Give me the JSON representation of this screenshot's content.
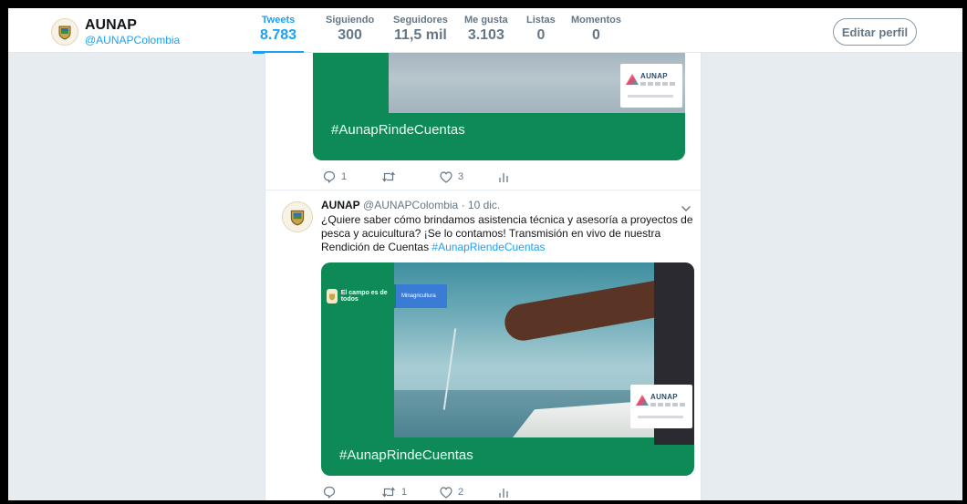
{
  "profile": {
    "name": "AUNAP",
    "handle": "@AUNAPColombia"
  },
  "stats": [
    {
      "label": "Tweets",
      "value": "8.783"
    },
    {
      "label": "Siguiendo",
      "value": "300"
    },
    {
      "label": "Seguidores",
      "value": "11,5 mil"
    },
    {
      "label": "Me gusta",
      "value": "3.103"
    },
    {
      "label": "Listas",
      "value": "0"
    },
    {
      "label": "Momentos",
      "value": "0"
    }
  ],
  "edit_profile_label": "Editar perfil",
  "tweet1": {
    "card_hashtag": "#AunapRindeCuentas",
    "badge_text": "AUNAP",
    "reply_count": "1",
    "retweet_count": "",
    "like_count": "3"
  },
  "tweet2": {
    "user_name": "AUNAP",
    "handle": "@AUNAPColombia",
    "date": "· 10 dic.",
    "text": "¿Quiere saber cómo brindamos asistencia técnica y asesoría a proyectos de pesca y acuicultura? ¡Se lo contamos! Transmisión en vivo de nuestra Rendición de Cuentas",
    "hashtag": "#AunapRiendeCuentas",
    "card_hashtag": "#AunapRindeCuentas",
    "brand_left": "El campo es de todos",
    "brand_right": "Minagricultura",
    "badge_text": "AUNAP",
    "reply_count": "",
    "retweet_count": "1",
    "like_count": "2"
  },
  "colors": {
    "accent": "#1da1f2",
    "card_green": "#0d8a56",
    "page_bg": "#e6ecf0"
  }
}
